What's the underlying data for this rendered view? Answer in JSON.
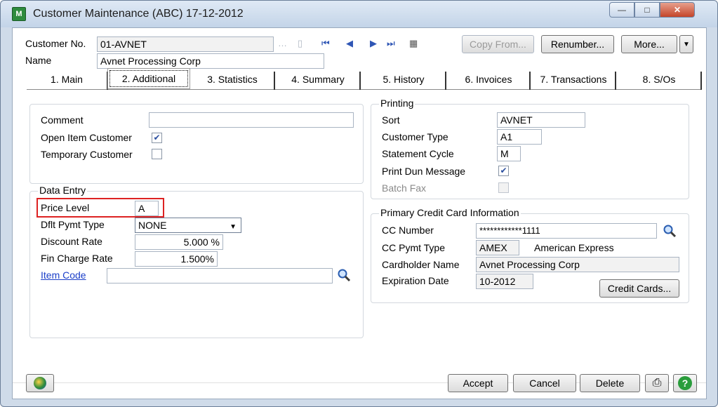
{
  "window": {
    "title": "Customer Maintenance (ABC) 17-12-2012",
    "icon_text": "M"
  },
  "header": {
    "customer_no_label": "Customer No.",
    "customer_no_value": "01-AVNET",
    "name_label": "Name",
    "name_value": "Avnet Processing Corp",
    "copy_from": "Copy From...",
    "renumber": "Renumber...",
    "more": "More..."
  },
  "tabs": [
    {
      "label": "1. Main"
    },
    {
      "label": "2. Additional"
    },
    {
      "label": "3. Statistics"
    },
    {
      "label": "4. Summary"
    },
    {
      "label": "5. History"
    },
    {
      "label": "6. Invoices"
    },
    {
      "label": "7. Transactions"
    },
    {
      "label": "8. S/Os"
    }
  ],
  "left": {
    "comment_label": "Comment",
    "comment_value": "",
    "open_item_label": "Open Item Customer",
    "open_item_checked": true,
    "temporary_label": "Temporary Customer",
    "temporary_checked": false,
    "data_entry_title": "Data Entry",
    "price_level_label": "Price Level",
    "price_level_value": "A",
    "dflt_pymt_label": "Dflt Pymt Type",
    "dflt_pymt_value": "NONE",
    "discount_label": "Discount Rate",
    "discount_value": "5.000 %",
    "fin_charge_label": "Fin Charge Rate",
    "fin_charge_value": "1.500%",
    "item_code_label": "Item Code",
    "item_code_value": ""
  },
  "printing": {
    "title": "Printing",
    "sort_label": "Sort",
    "sort_value": "AVNET",
    "customer_type_label": "Customer Type",
    "customer_type_value": "A1",
    "statement_cycle_label": "Statement Cycle",
    "statement_cycle_value": "M",
    "print_dun_label": "Print Dun Message",
    "print_dun_checked": true,
    "batch_fax_label": "Batch Fax",
    "batch_fax_checked": false
  },
  "credit_card": {
    "title": "Primary Credit Card Information",
    "cc_number_label": "CC Number",
    "cc_number_value": "************1111",
    "cc_pymt_label": "CC Pymt Type",
    "cc_pymt_code": "AMEX",
    "cc_pymt_desc": "American Express",
    "cardholder_label": "Cardholder Name",
    "cardholder_value": "Avnet Processing Corp",
    "expiration_label": "Expiration Date",
    "expiration_value": "10-2012",
    "credit_cards_button": "Credit Cards..."
  },
  "footer": {
    "accept": "Accept",
    "cancel": "Cancel",
    "delete": "Delete"
  },
  "colors": {
    "window_bg": "#cfdbe9",
    "link": "#1b3fc9",
    "highlight_box": "#dd2222"
  }
}
